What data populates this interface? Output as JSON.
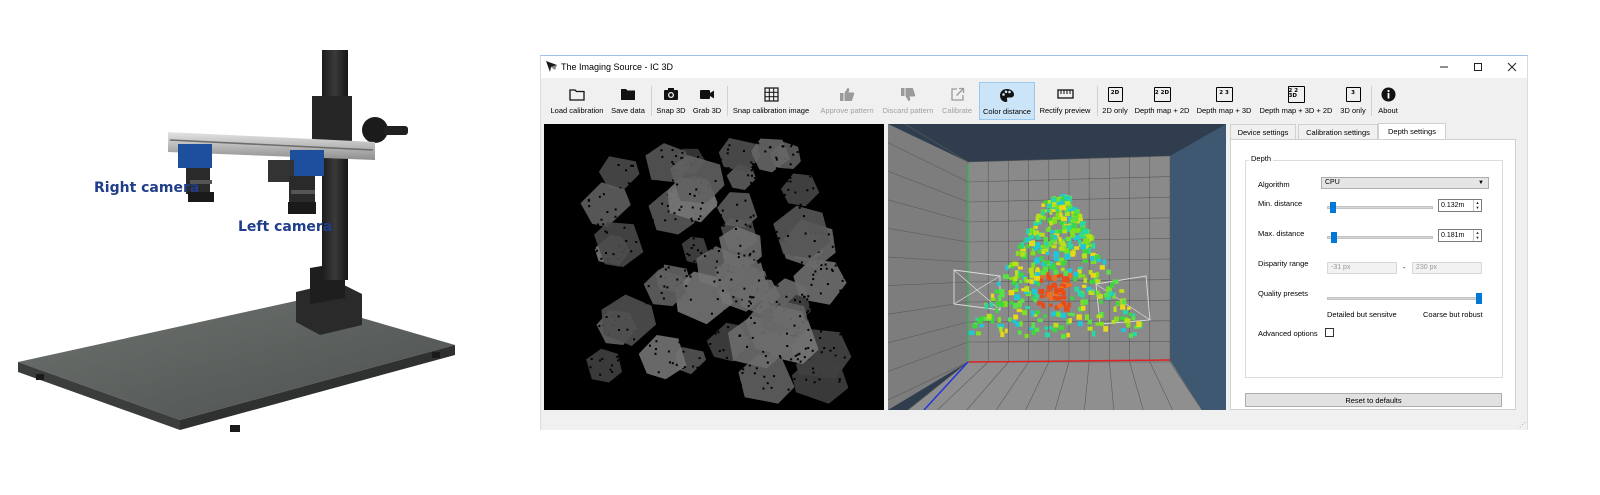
{
  "labels": {
    "right_camera": "Right camera",
    "left_camera": "Left camera"
  },
  "window": {
    "title": "The Imaging Source - IC 3D",
    "min_icon": "minimize-icon",
    "max_icon": "maximize-icon",
    "close_icon": "close-icon"
  },
  "toolbar": {
    "load_calibration": "Load calibration",
    "save_data": "Save data",
    "snap_3d": "Snap 3D",
    "grab_3d": "Grab 3D",
    "snap_calibration_image": "Snap calibration image",
    "approve_pattern": "Approve pattern",
    "discard_pattern": "Discard pattern",
    "calibrate": "Calibrate",
    "color_distance": "Color distance",
    "rectify_preview": "Rectify preview",
    "only_2d": "2D only",
    "depth_2d": "Depth map + 2D",
    "depth_3d": "Depth map + 3D",
    "depth_3d_2d": "Depth map + 3D + 2D",
    "only_3d": "3D only",
    "about": "About",
    "num_2d": "2D",
    "num_d2": "2 2D",
    "num_d3": "2 3",
    "num_d32": "2 2 3D",
    "num_3": "3"
  },
  "panel": {
    "tabs": [
      "Device settings",
      "Calibration settings",
      "Depth settings"
    ],
    "active_tab": "Depth settings",
    "group": "Depth",
    "algorithm_label": "Algorithm",
    "algorithm_value": "CPU",
    "min_distance_label": "Min. distance",
    "min_distance_value": "0.132m",
    "min_distance_slider": 0.02,
    "max_distance_label": "Max. distance",
    "max_distance_value": "0.181m",
    "max_distance_slider": 0.03,
    "disparity_label": "Disparity range",
    "disparity_min": "-31 px",
    "disparity_sep": "-",
    "disparity_max": "230 px",
    "quality_label": "Quality presets",
    "quality_slider": 1.0,
    "quality_left": "Detailed but sensitve",
    "quality_right": "Coarse but robust",
    "advanced_label": "Advanced options",
    "advanced_checked": false,
    "reset": "Reset to defaults"
  },
  "colors": {
    "accent": "#0078d7",
    "active_tool_bg": "#cce4f7",
    "camera_label": "#1f3d8a"
  }
}
